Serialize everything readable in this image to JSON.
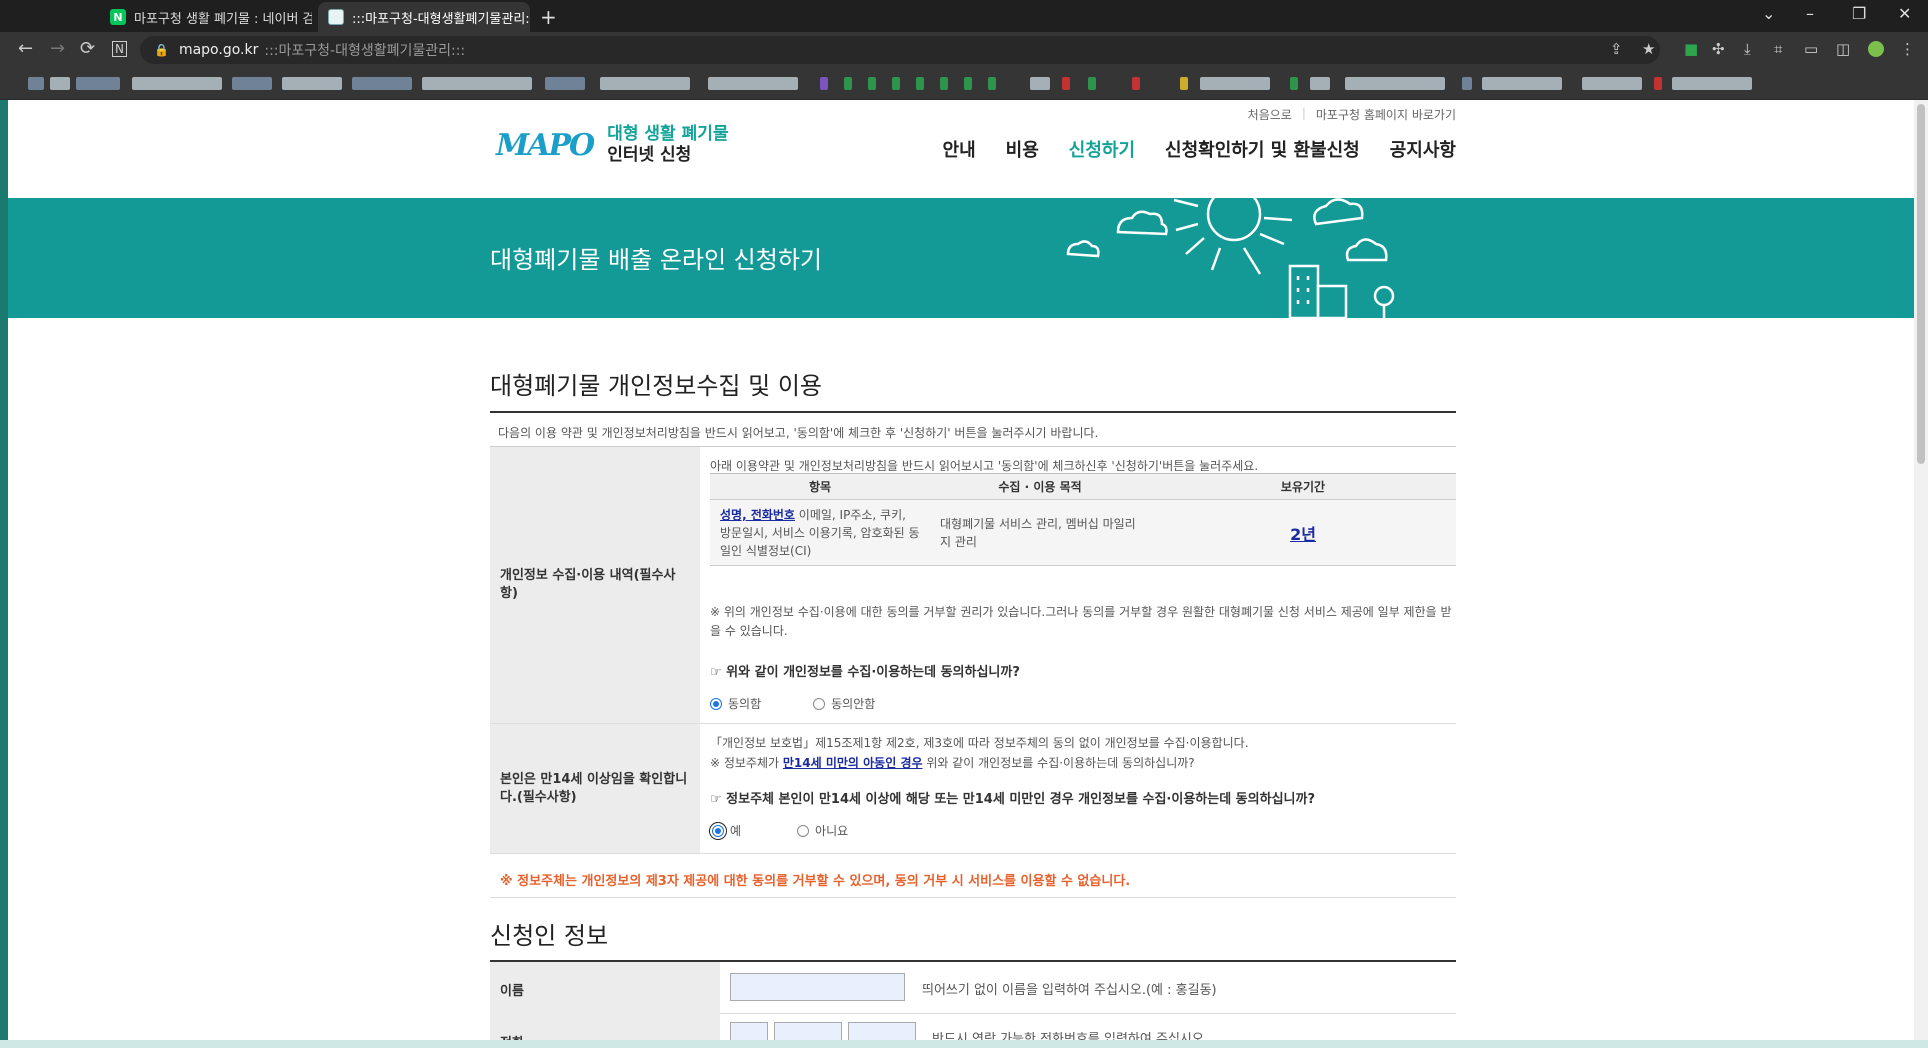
{
  "browser": {
    "tabs": [
      {
        "title": "마포구청 생활 폐기물 : 네이버 검",
        "favicon": "N"
      },
      {
        "title": ":::마포구청-대형생활폐기물관리:::",
        "favicon": ""
      }
    ],
    "url_host": "mapo.go.kr",
    "url_path": ":::마포구청-대형생활폐기물관리:::",
    "new_tab": "+",
    "back": "←",
    "forward": "→",
    "reload": "⟳",
    "minimize": "–",
    "restore": "❐",
    "close": "✕",
    "chevron": "⌄"
  },
  "header": {
    "util_links": [
      "처음으로",
      "마포구청 홈페이지 바로가기"
    ],
    "logo_mark": "MAPO",
    "logo_line1": "대형 생활 폐기물",
    "logo_line2": "인터넷 신청",
    "nav": [
      "안내",
      "비용",
      "신청하기",
      "신청확인하기 및 환불신청",
      "공지사항"
    ],
    "nav_active": "신청하기"
  },
  "hero": {
    "title": "대형폐기물 배출 온라인 신청하기"
  },
  "privacy": {
    "section_title": "대형폐기물 개인정보수집 및 이용",
    "intro": "다음의 이용 약관 및 개인정보처리방침을 반드시 읽어보고, '동의함'에 체크한 후 '신청하기' 버튼을 눌러주시기 바랍니다.",
    "row1": {
      "label": "개인정보 수집·이용 내역(필수사항)",
      "lead": "아래 이용약관 및 개인정보처리방침을 반드시 읽어보시고 '동의함'에 체크하신후 '신청하기'버튼을 눌러주세요.",
      "headers": [
        "항목",
        "수집 · 이용 목적",
        "보유기간"
      ],
      "item_link": "성명, 전화번호",
      "item_rest": " 이메일, IP주소, 쿠키, 방문일시, 서비스 이용기록, 암호화된 동일인 식별정보(CI)",
      "purpose": "대형폐기물 서비스 관리, 멤버십 마일리지 관리",
      "retention": "2년",
      "note": "※ 위의 개인정보 수집·이용에 대한 동의를 거부할 권리가 있습니다.그러나 동의를 거부할 경우 원활한 대형폐기물 신청 서비스 제공에 일부 제한을 받을 수 있습니다.",
      "question": "☞ 위와 같이 개인정보를 수집·이용하는데 동의하십니까?",
      "agree": "동의함",
      "disagree": "동의안함"
    },
    "row2": {
      "label": "본인은 만14세 이상임을 확인합니다.(필수사항)",
      "line1": "「개인정보 보호법」제15조제1항 제2호, 제3호에 따라 정보주체의 동의 없이 개인정보를 수집·이용합니다.",
      "line2_pre": "※ 정보주체가 ",
      "line2_link": "만14세 미만의 아동인 경우",
      "line2_post": " 위와 같이 개인정보를 수집·이용하는데 동의하십니까?",
      "question": "☞ 정보주체 본인이 만14세 이상에 해당 또는 만14세 미만인 경우 개인정보를 수집·이용하는데 동의하십니까?",
      "yes": "예",
      "no": "아니요"
    },
    "warning": "※ 정보주체는 개인정보의 제3자 제공에 대한 동의를 거부할 수 있으며, 동의 거부 시 서비스를 이용할 수 없습니다."
  },
  "applicant": {
    "section_title": "신청인 정보",
    "name_label": "이름",
    "name_value": "",
    "name_hint": "띄어쓰기 없이 이름을 입력하여 주십시오.(예 : 홍길동)",
    "phone_label": "전화",
    "phone_hint": "반드시 연락 가능한 전화번호를 입력하여 주십시오."
  },
  "colors": {
    "teal": "#139a97",
    "accent_text": "#14a39a",
    "warning": "#e8612c",
    "link": "#1a2aa0"
  }
}
